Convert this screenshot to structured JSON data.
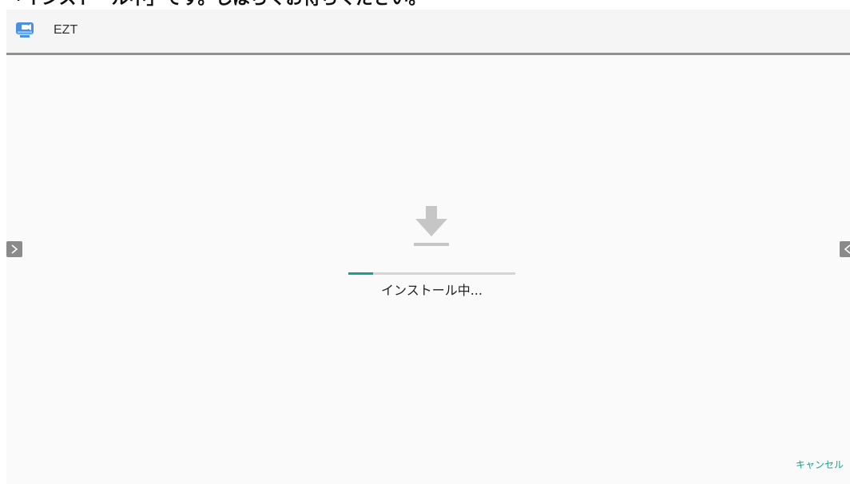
{
  "caption": "「インストール中」です。しばらくお待ちください。",
  "app": {
    "name": "EZT",
    "icon": "ezt-app-icon"
  },
  "install": {
    "status_text": "インストール中...",
    "progress": 0.15,
    "icon": "download-icon"
  },
  "actions": {
    "cancel_label": "キャンセル"
  },
  "nav": {
    "left_icon": "chevron-right-icon",
    "right_icon": "chevron-left-icon"
  },
  "colors": {
    "accent": "#1a9f8f",
    "background": "#fafafa",
    "track": "#d5d5d5",
    "icon_gray": "#c6c6c6"
  }
}
